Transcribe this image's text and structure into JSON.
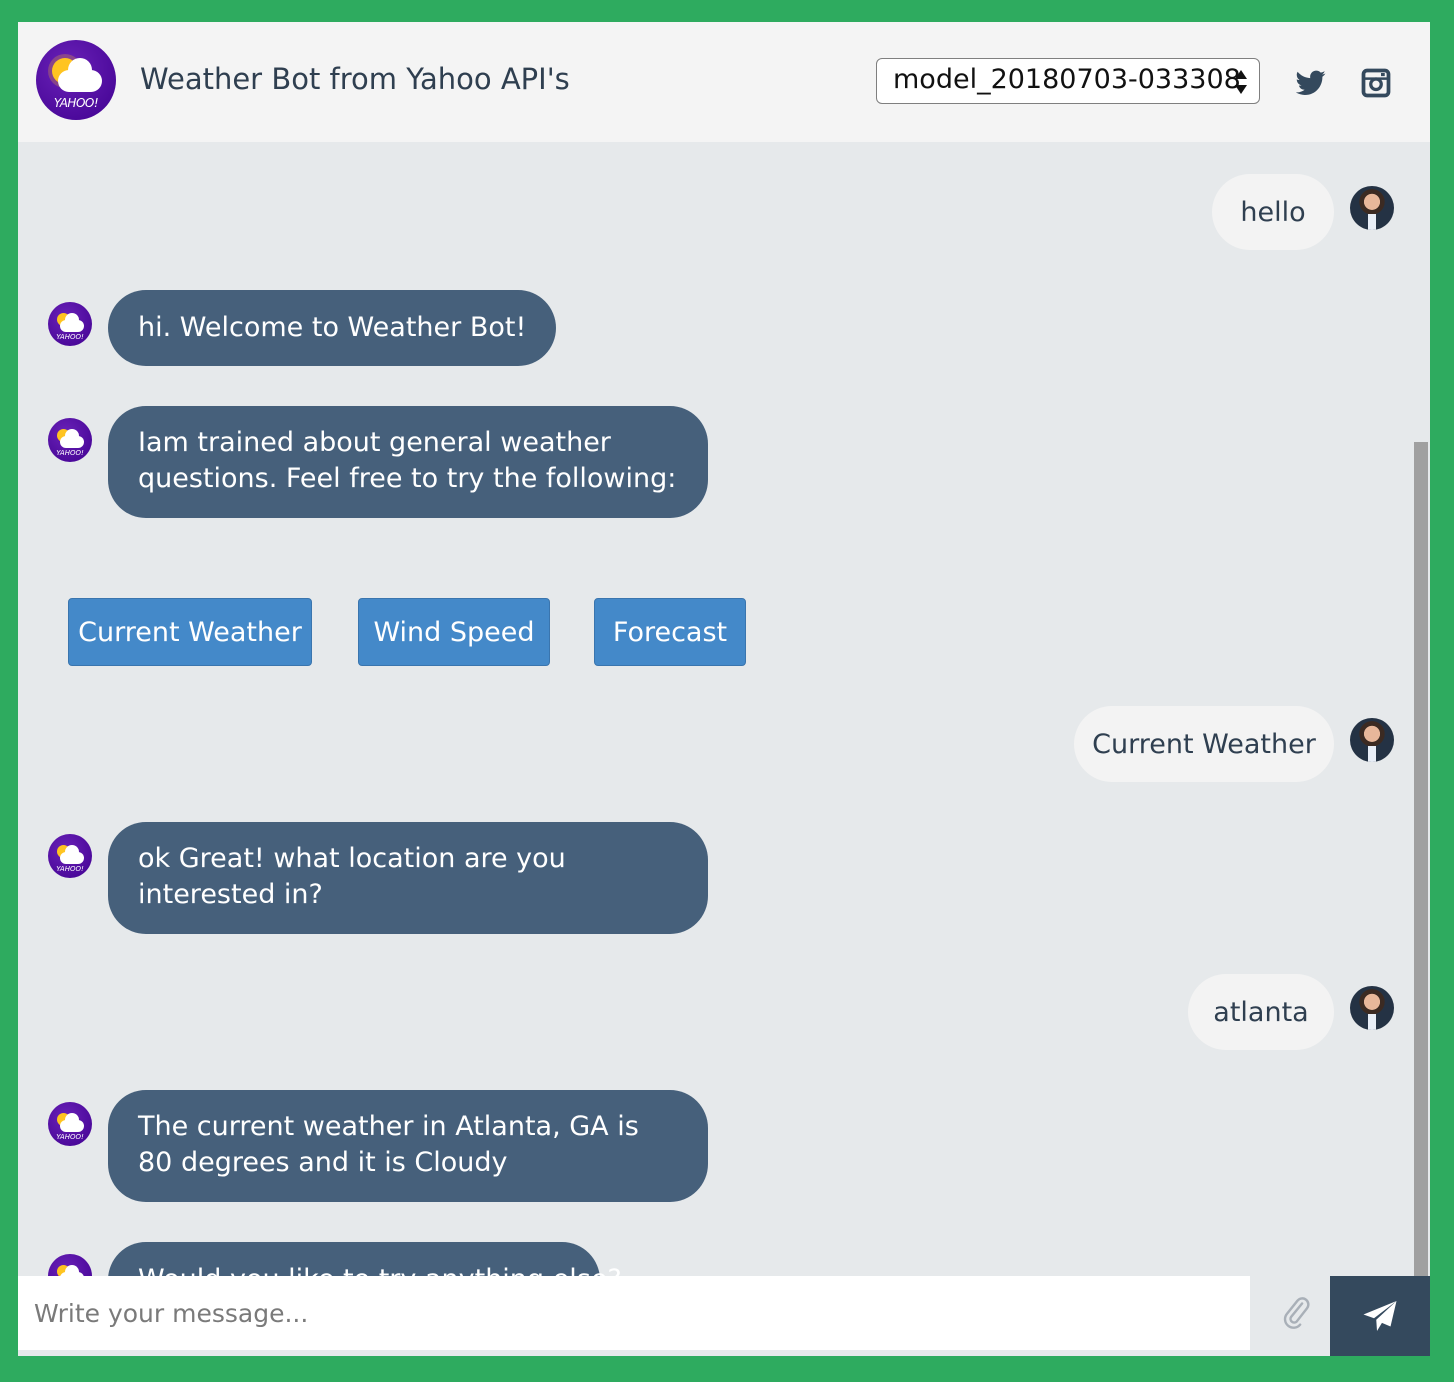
{
  "header": {
    "title": "Weather Bot from Yahoo API's",
    "logo_text": "YAHOO!",
    "model_select_value": "model_20180703-033308",
    "social_icons": [
      "twitter-icon",
      "instagram-icon"
    ]
  },
  "messages": [
    {
      "from": "user",
      "text": "hello"
    },
    {
      "from": "bot",
      "text": "hi. Welcome to Weather Bot!"
    },
    {
      "from": "bot",
      "text": "Iam trained about general weather questions. Feel free to try the following:"
    },
    {
      "from": "user",
      "text": "Current Weather"
    },
    {
      "from": "bot",
      "text": "ok Great! what location are you interested in?"
    },
    {
      "from": "user",
      "text": "atlanta"
    },
    {
      "from": "bot",
      "text": "The current weather in Atlanta, GA is 80 degrees and it is Cloudy"
    },
    {
      "from": "bot",
      "text": "Would you like to try anything else?"
    }
  ],
  "suggestions": [
    "Current Weather",
    "Wind Speed",
    "Forecast"
  ],
  "composer": {
    "placeholder": "Write your message...",
    "attach_icon": "paperclip-icon",
    "send_icon": "send-icon"
  },
  "colors": {
    "page_border": "#2eab5f",
    "header_bg": "#f4f4f4",
    "chat_bg": "#e6e9eb",
    "bot_bubble": "#46607b",
    "user_bubble": "#f3f3f3",
    "suggestion_button": "#4489c9",
    "send_button": "#34495d",
    "avatar_purple": "#400090"
  }
}
